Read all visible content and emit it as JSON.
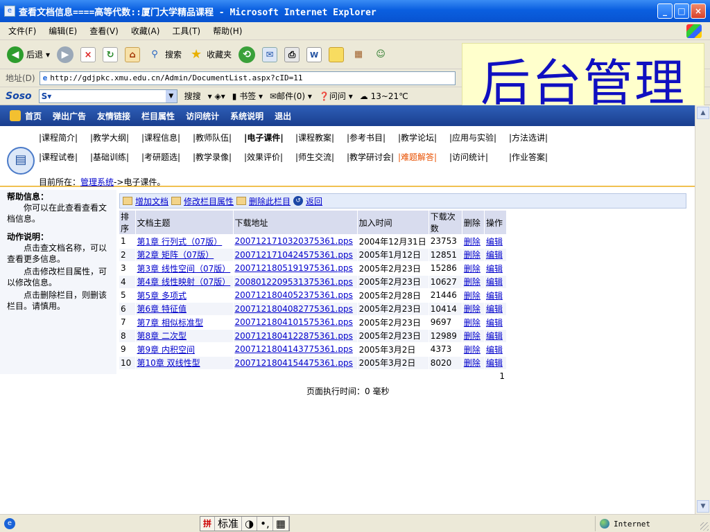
{
  "window": {
    "title": "查看文档信息====高等代数::厦门大学精品课程 - Microsoft Internet Explorer"
  },
  "menu": [
    "文件(F)",
    "编辑(E)",
    "查看(V)",
    "收藏(A)",
    "工具(T)",
    "帮助(H)"
  ],
  "toolbar": {
    "back": "后退",
    "search": "搜索",
    "favorites": "收藏夹"
  },
  "address": {
    "label": "地址(D)",
    "url": "http://gdjpkc.xmu.edu.cn/Admin/DocumentList.aspx?cID=11"
  },
  "soso": {
    "logo": "Soso",
    "search": "搜搜",
    "bookmarks": "书签",
    "mail": "邮件(0)",
    "ask": "问问",
    "weather": "13~21℃"
  },
  "overlay_title": "后台管理",
  "nav": [
    "首页",
    "弹出广告",
    "友情链接",
    "栏目属性",
    "访问统计",
    "系统说明",
    "退出"
  ],
  "categories": {
    "row1": [
      "|课程简介|",
      "|教学大纲|",
      "|课程信息|",
      "|教师队伍|",
      "|电子课件|",
      "|课程教案|",
      "|参考书目|",
      "|教学论坛|",
      "|应用与实验|",
      "|方法选讲|"
    ],
    "row2": [
      "|课程试卷|",
      "|基础训练|",
      "|考研题选|",
      "|教学录像|",
      "|效果评价|",
      "|师生交流|",
      "|教学研讨会|",
      "|难题解答|",
      "|访问统计|",
      "|作业答案|"
    ]
  },
  "breadcrumb": {
    "prefix": "目前所在：",
    "link": "管理系统",
    "suffix": "->电子课件。"
  },
  "help": {
    "title": "帮助信息：",
    "text": "你可以在此查看查看文档信息。",
    "action_title": "动作说明：",
    "actions": [
      "点击查文档名称，可以查看更多信息。",
      "点击修改栏目属性，可以修改信息。",
      "点击删除栏目，则删该栏目。请慎用。"
    ]
  },
  "actions": {
    "add": "增加文档",
    "edit": "修改栏目属性",
    "delete": "删除此栏目",
    "back": "返回"
  },
  "table": {
    "headers": [
      "排序",
      "文档主题",
      "下载地址",
      "加入时间",
      "下载次数",
      "删除",
      "操作"
    ],
    "rows": [
      [
        "1",
        "第1章 行列式（07版）",
        "2007121710320375361.pps",
        "2004年12月31日",
        "23753",
        "删除",
        "编辑"
      ],
      [
        "2",
        "第2章 矩阵（07版）",
        "2007121710424575361.pps",
        "2005年1月12日",
        "12851",
        "删除",
        "编辑"
      ],
      [
        "3",
        "第3章 线性空间（07版）",
        "2007121805191975361.pps",
        "2005年2月23日",
        "15286",
        "删除",
        "编辑"
      ],
      [
        "4",
        "第4章 线性映射（07版）",
        "2008012209531375361.pps",
        "2005年2月23日",
        "10627",
        "删除",
        "编辑"
      ],
      [
        "5",
        "第5章 多项式",
        "2007121804052375361.pps",
        "2005年2月28日",
        "21446",
        "删除",
        "编辑"
      ],
      [
        "6",
        "第6章 特征值",
        "2007121804082775361.pps",
        "2005年2月23日",
        "10414",
        "删除",
        "编辑"
      ],
      [
        "7",
        "第7章 相似标准型",
        "2007121804101575361.pps",
        "2005年2月23日",
        "9697",
        "删除",
        "编辑"
      ],
      [
        "8",
        "第8章 二次型",
        "2007121804122875361.pps",
        "2005年2月23日",
        "12989",
        "删除",
        "编辑"
      ],
      [
        "9",
        "第9章 内积空间",
        "2007121804143775361.pps",
        "2005年3月2日",
        "4373",
        "删除",
        "编辑"
      ],
      [
        "10",
        "第10章 双线性型",
        "2007121804154475361.pps",
        "2005年3月2日",
        "8020",
        "删除",
        "编辑"
      ]
    ],
    "page": "1"
  },
  "exec_time": "页面执行时间：0 毫秒",
  "status": {
    "ime": [
      "标准"
    ],
    "zone": "Internet"
  }
}
